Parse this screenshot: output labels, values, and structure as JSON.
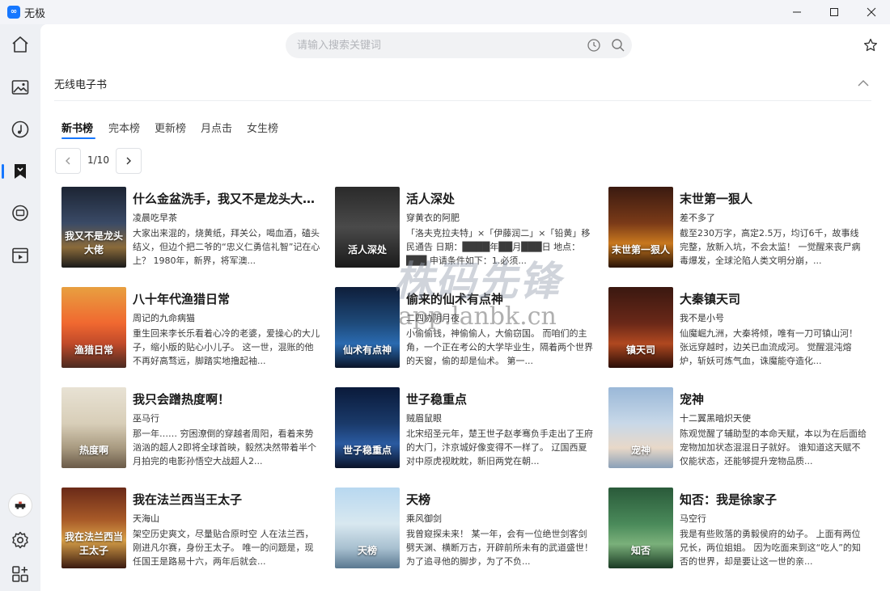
{
  "app": {
    "title": "无极"
  },
  "search": {
    "placeholder": "请输入搜索关键词"
  },
  "source": {
    "title": "无线电子书"
  },
  "tabs": [
    {
      "label": "新书榜"
    },
    {
      "label": "完本榜"
    },
    {
      "label": "更新榜"
    },
    {
      "label": "月点击"
    },
    {
      "label": "女生榜"
    }
  ],
  "pager": {
    "label": "1/10"
  },
  "colors": {
    "accent": "#1677ff"
  },
  "books": [
    {
      "title": "什么金盆洗手，我又不是龙头大佬！",
      "author": "凌晨吃早茶",
      "desc": "大家出来混的，烧黄纸，拜关公，喝血酒，磕头结义，但边个把二爷的“忠义仁勇信礼智”记在心上？ 1980年，新界，将军澳...",
      "cover_text": "我又不是龙头大佬",
      "cover_bg": "linear-gradient(180deg,#1c2433 0%,#3a4a66 45%,#8a6a3a 75%,#1a1a1a 100%)"
    },
    {
      "title": "活人深处",
      "author": "穿黄衣的阿肥",
      "desc": "「洛夫克拉夫特」×「伊藤润二」×「铅黄」移民通告 日期：████年██月███日 地点：███ 申请条件如下：1.必须...",
      "cover_text": "活人深处",
      "cover_bg": "linear-gradient(180deg,#2a2a2a 0%,#4a4a4a 50%,#1a1a1a 100%)"
    },
    {
      "title": "末世第一狠人",
      "author": "差不多了",
      "desc": "截至230万字，高定2.5万，均订6千，故事线完整，放新入坑，不会太监！ 一觉醒来丧尸病毒爆发，全球沦陷人类文明分崩，...",
      "cover_text": "末世第一狠人",
      "cover_bg": "linear-gradient(180deg,#3a1a10 0%,#7a3a18 45%,#c8781e 70%,#2a1408 100%)"
    },
    {
      "title": "八十年代渔猎日常",
      "author": "周记的九命病猫",
      "desc": "重生回来李长乐看着心冷的老婆，爱操心的大儿子，缩小版的贴心小儿子。 这一世，混账的他不再好高骛远，脚踏实地撸起袖...",
      "cover_text": "渔猎日常",
      "cover_bg": "linear-gradient(180deg,#e8a040 0%,#f06830 45%,#c04a2a 70%,#4a2a20 100%)"
    },
    {
      "title": "偷来的仙术有点神",
      "author": "二四协阴月夜",
      "desc": "小偷偷钱，神偷偷人，大偷窃国。 而咱们的主角，一个正在考公的大学毕业生，隔着两个世界的天窗，偷的却是仙术。 第一...",
      "cover_text": "仙术有点神",
      "cover_bg": "linear-gradient(180deg,#0e1e3a 0%,#1e4a7a 45%,#2a6ab0 70%,#0a1428 100%)"
    },
    {
      "title": "大秦镇天司",
      "author": "我不是小号",
      "desc": "仙魔崛九洲，大秦将倾，唯有一刀可镇山河！ 张远穿越时，边关已血流成河。 觉醒混沌熔炉，斩妖可炼气血，诛魔能夺造化...",
      "cover_text": "镇天司",
      "cover_bg": "linear-gradient(180deg,#3a1810 0%,#6a2818 45%,#b04820 70%,#2a0e08 100%)"
    },
    {
      "title": "我只会蹭热度啊！",
      "author": "巫马行",
      "desc": "那一年…… 穷困潦倒的穿越者周阳，看着来势汹汹的超人2即将全球首映，毅然决然带着半个月拍完的电影孙悟空大战超人2...",
      "cover_text": "热度啊",
      "cover_bg": "linear-gradient(180deg,#e8e2d4 0%,#d8ceb8 45%,#a89a80 75%,#6a5a48 100%)"
    },
    {
      "title": "世子稳重点",
      "author": "贼眉鼠眼",
      "desc": "北宋绍圣元年，楚王世子赵孝骞负手走出了王府的大门，汴京城好像变得不一样了。 辽国西夏对中原虎视眈眈，新旧两党在朝...",
      "cover_text": "世子稳重点",
      "cover_bg": "linear-gradient(180deg,#0a1a3a 0%,#1a3a6a 45%,#2a5aa0 70%,#0a1228 100%)"
    },
    {
      "title": "宠神",
      "author": "十二翼黑暗炽天使",
      "desc": "陈观觉醒了辅助型的本命天赋，本以为在后面给宠物加加状态混混日子就好。 谁知道这天赋不仅能状态，还能够提升宠物品质...",
      "cover_text": "宠神",
      "cover_bg": "linear-gradient(180deg,#9ab8d8 0%,#c8d8e8 45%,#e8d8c8 75%,#8aa0b8 100%)"
    },
    {
      "title": "我在法兰西当王太子",
      "author": "天海山",
      "desc": "架空历史爽文，尽量贴合原时空 人在法兰西，刚进凡尔赛，身份王太子。 唯一的问题是，现任国王是路易十六，两年后就会...",
      "cover_text": "我在法兰西当王太子",
      "cover_bg": "linear-gradient(180deg,#6a2a18 0%,#a85a28 40%,#d8a048 65%,#3a1a10 100%)"
    },
    {
      "title": "天榜",
      "author": "乘风御剑",
      "desc": "我曾窥探未来！ 某一年，会有一位绝世剑客剑劈天渊、横断万古，开辟前所未有的武道盛世！ 为了追寻他的脚步，为了不负...",
      "cover_text": "天榜",
      "cover_bg": "linear-gradient(180deg,#b8d8f0 0%,#d8e8f0 45%,#a8c0d0 75%,#5a7890 100%)"
    },
    {
      "title": "知否：我是徐家子",
      "author": "马空行",
      "desc": "我是有些败落的勇毅侯府的幼子。 上面有两位兄长，两位姐姐。 因为吃面来到这“吃人”的知否的世界，却是要让这一世的亲...",
      "cover_text": "知否",
      "cover_bg": "linear-gradient(180deg,#2a5a3a 0%,#4a8a5a 45%,#7ab07a 70%,#1a3a24 100%)"
    }
  ],
  "watermark": {
    "line1": "株码先锋",
    "line2": "app.lanbk.cn"
  }
}
